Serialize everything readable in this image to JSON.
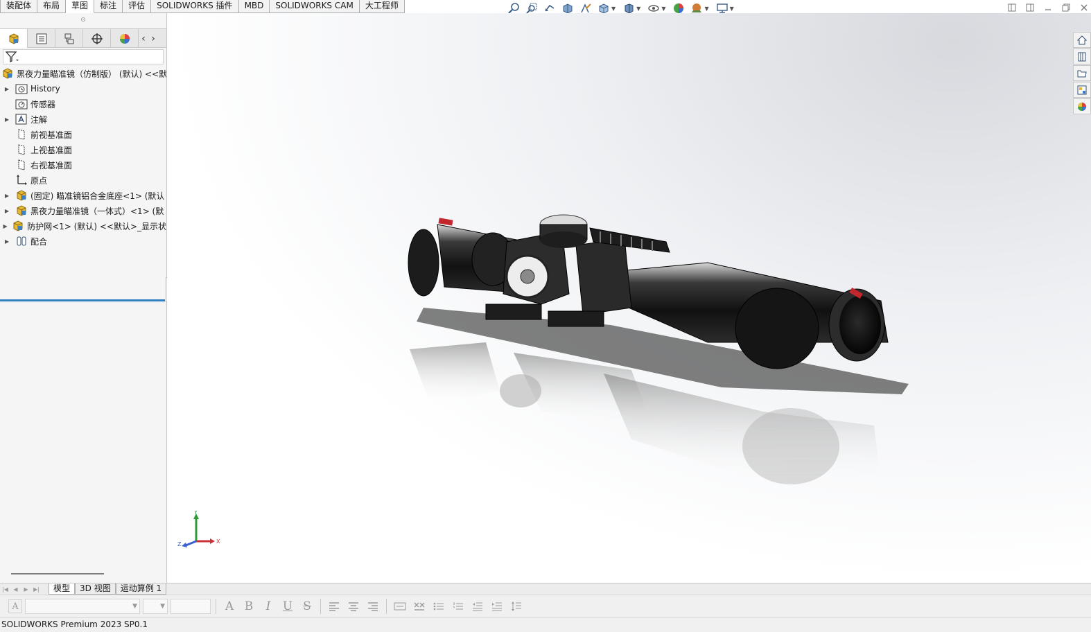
{
  "command_tabs": [
    {
      "label": "装配体",
      "active": false
    },
    {
      "label": "布局",
      "active": false
    },
    {
      "label": "草图",
      "active": true
    },
    {
      "label": "标注",
      "active": false
    },
    {
      "label": "评估",
      "active": false
    },
    {
      "label": "SOLIDWORKS 插件",
      "active": false
    },
    {
      "label": "MBD",
      "active": false
    },
    {
      "label": "SOLIDWORKS CAM",
      "active": false
    },
    {
      "label": "大工程师",
      "active": false
    }
  ],
  "heads_up_toolbar": [
    "zoom-to-fit-icon",
    "zoom-to-area-icon",
    "previous-view-icon",
    "section-view-icon",
    "dynamic-annotation-icon",
    "view-orientation-icon",
    "display-style-icon",
    "hide-show-items-icon",
    "edit-appearance-icon",
    "apply-scene-icon",
    "view-settings-icon"
  ],
  "window_controls": [
    "tile-left-icon",
    "tile-right-icon",
    "minimize-icon",
    "restore-icon",
    "close-icon"
  ],
  "feature_tree": {
    "tabs": [
      "feature-manager-icon",
      "property-manager-icon",
      "configuration-manager-icon",
      "dimxpert-icon",
      "display-manager-icon"
    ],
    "root": {
      "label": "黑夜力量瞄准镜（仿制版） (默认) <<默"
    },
    "items": [
      {
        "label": "History",
        "expandable": true,
        "icon": "history-folder-icon"
      },
      {
        "label": "传感器",
        "expandable": false,
        "icon": "sensor-folder-icon"
      },
      {
        "label": "注解",
        "expandable": true,
        "icon": "annotations-icon"
      },
      {
        "label": "前视基准面",
        "expandable": false,
        "icon": "plane-icon"
      },
      {
        "label": "上视基准面",
        "expandable": false,
        "icon": "plane-icon"
      },
      {
        "label": "右视基准面",
        "expandable": false,
        "icon": "plane-icon"
      },
      {
        "label": "原点",
        "expandable": false,
        "icon": "origin-icon"
      },
      {
        "label": "(固定) 瞄准镜铝合金底座<1> (默认",
        "expandable": true,
        "icon": "part-icon"
      },
      {
        "label": "黑夜力量瞄准镜（一体式）<1> (默",
        "expandable": true,
        "icon": "part-icon"
      },
      {
        "label": "防护网<1> (默认) <<默认>_显示状",
        "expandable": true,
        "icon": "part-icon"
      },
      {
        "label": "配合",
        "expandable": true,
        "icon": "mates-icon"
      }
    ]
  },
  "taskpane": [
    "home-icon",
    "design-library-icon",
    "file-explorer-icon",
    "view-palette-icon",
    "appearances-icon"
  ],
  "triad": {
    "x": "X",
    "y": "Y",
    "z": "Z"
  },
  "bottom_tabs": [
    {
      "label": "模型",
      "active": true
    },
    {
      "label": "3D 视图",
      "active": false
    },
    {
      "label": "运动算例 1",
      "active": false
    }
  ],
  "format_toolbar": {
    "font_value": "",
    "size_value": "",
    "style_buttons": [
      "A",
      "B",
      "I",
      "U",
      "S"
    ]
  },
  "status_bar": {
    "text": "SOLIDWORKS Premium 2023 SP0.1"
  },
  "colors": {
    "selection_blue": "#2d7fc1",
    "active_tab": "#ffffff",
    "panel_bg": "#f5f5f5"
  }
}
